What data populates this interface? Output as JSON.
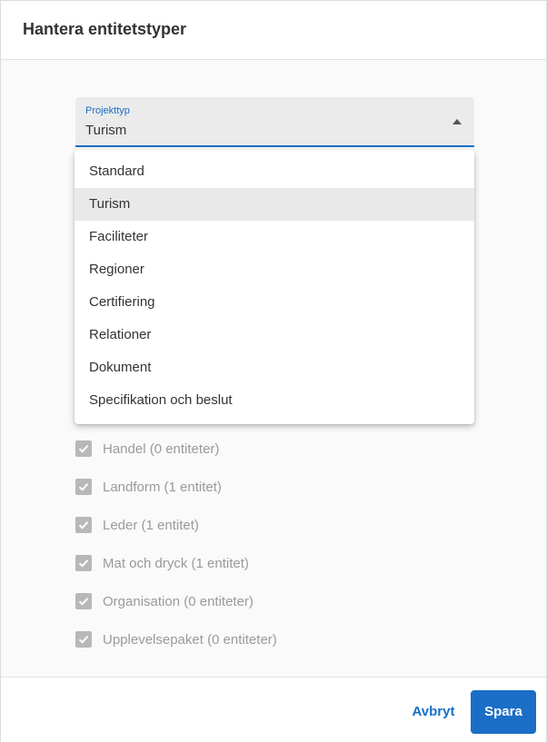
{
  "dialog": {
    "title": "Hantera entitetstyper"
  },
  "select": {
    "label": "Projekttyp",
    "value": "Turism",
    "options": [
      "Standard",
      "Turism",
      "Faciliteter",
      "Regioner",
      "Certifiering",
      "Relationer",
      "Dokument",
      "Specifikation och beslut"
    ],
    "selected_index": 1
  },
  "entity_types": [
    {
      "label": "Handel (0 entiteter)",
      "checked": true
    },
    {
      "label": "Landform (1 entitet)",
      "checked": true
    },
    {
      "label": "Leder (1 entitet)",
      "checked": true
    },
    {
      "label": "Mat och dryck (1 entitet)",
      "checked": true
    },
    {
      "label": "Organisation (0 entiteter)",
      "checked": true
    },
    {
      "label": "Upplevelsepaket (0 entiteter)",
      "checked": true
    }
  ],
  "footer": {
    "cancel_label": "Avbryt",
    "save_label": "Spara"
  },
  "colors": {
    "accent": "#1a6ec6",
    "checkbox_disabled": "#b8b8b8",
    "menu_selected_bg": "#e9e9e9"
  }
}
